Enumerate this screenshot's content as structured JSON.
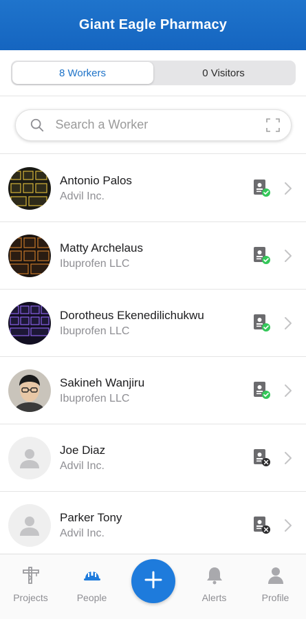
{
  "header": {
    "title": "Giant Eagle Pharmacy"
  },
  "segments": {
    "workers_label": "8 Workers",
    "visitors_label": "0 Visitors"
  },
  "search": {
    "placeholder": "Search a Worker",
    "value": ""
  },
  "workers": [
    {
      "name": "Antonio Palos",
      "company": "Advil Inc.",
      "status": "verified",
      "avatar": "keyboard-yellow-photo"
    },
    {
      "name": "Matty Archelaus",
      "company": "Ibuprofen LLC",
      "status": "verified",
      "avatar": "keyboard-orange-photo"
    },
    {
      "name": "Dorotheus Ekenedilichukwu",
      "company": "Ibuprofen LLC",
      "status": "verified",
      "avatar": "keyboard-purple-photo"
    },
    {
      "name": "Sakineh Wanjiru",
      "company": "Ibuprofen LLC",
      "status": "verified",
      "avatar": "person-photo"
    },
    {
      "name": "Joe Diaz",
      "company": "Advil Inc.",
      "status": "unverified",
      "avatar": "default-avatar"
    },
    {
      "name": "Parker Tony",
      "company": "Advil Inc.",
      "status": "unverified",
      "avatar": "default-avatar"
    }
  ],
  "tabs": {
    "projects": "Projects",
    "people": "People",
    "alerts": "Alerts",
    "profile": "Profile"
  },
  "colors": {
    "primary": "#1e73c8",
    "verified": "#34c759",
    "unverified": "#2c2c2e"
  }
}
